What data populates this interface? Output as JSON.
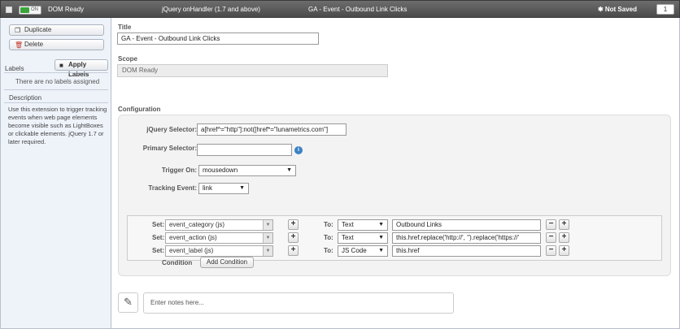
{
  "header": {
    "toggle_label": "ON",
    "event_type": "DOM Ready",
    "handler": "jQuery onHandler (1.7 and above)",
    "tag_name": "GA - Event - Outbound Link Clicks",
    "save_status": "✱ Not Saved",
    "count": "1"
  },
  "sidebar": {
    "duplicate_label": "Duplicate",
    "delete_label": "Delete",
    "labels_heading": "Labels",
    "apply_labels_label": "Apply Labels",
    "no_labels_text": "There are no labels assigned",
    "description_heading": "Description",
    "description_text": "Use this extension to trigger tracking events when web page elements become visible such as LightBoxes or clickable elements. jQuery 1.7 or later required."
  },
  "form": {
    "title_label": "Title",
    "title_value": "GA - Event - Outbound Link Clicks",
    "scope_label": "Scope",
    "scope_value": "DOM Ready",
    "configuration_label": "Configuration",
    "jquery_selector_label": "jQuery Selector:",
    "jquery_selector_value": "a[href^=\"http\"]:not([href*=\"lunametrics.com\"]",
    "primary_selector_label": "Primary Selector:",
    "primary_selector_value": "",
    "trigger_on_label": "Trigger On:",
    "trigger_on_value": "mousedown",
    "tracking_event_label": "Tracking Event:",
    "tracking_event_value": "link",
    "set_label": "Set:",
    "to_label": "To:",
    "rows": [
      {
        "set": "event_category (js)",
        "type": "Text",
        "value": "Outbound Links"
      },
      {
        "set": "event_action (js)",
        "type": "Text",
        "value": "this.href.replace('http://', '').replace('https://'"
      },
      {
        "set": "event_label (js)",
        "type": "JS Code",
        "value": "this.href"
      }
    ],
    "condition_label": "Condition",
    "add_condition_label": "Add Condition"
  },
  "notes": {
    "placeholder": "Enter notes here..."
  },
  "icons": {
    "duplicate": "duplicate-icon",
    "delete": "trash-icon",
    "folder": "folder-icon",
    "info": "info-icon",
    "notes": "edit-icon"
  },
  "colors": {
    "titlebar": "#555555",
    "toggle_on": "#3aa53a",
    "sidebar_bg": "#eef3fa",
    "info_blue": "#3b82c4"
  }
}
